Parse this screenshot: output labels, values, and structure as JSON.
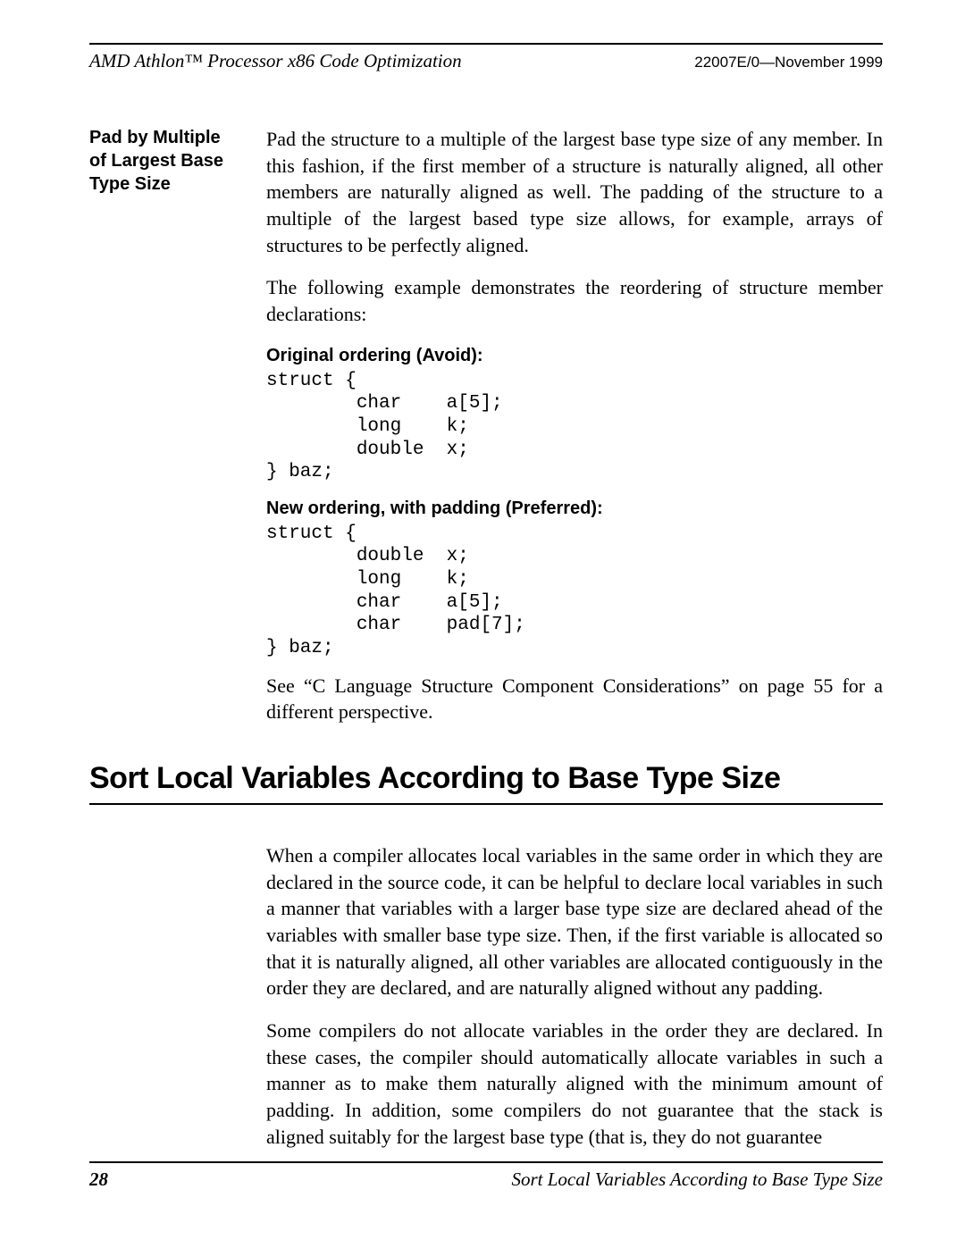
{
  "header": {
    "left": "AMD Athlon™ Processor x86 Code Optimization",
    "right": "22007E/0—November 1999"
  },
  "section1": {
    "side_heading": "Pad by Multiple of Largest Base Type Size",
    "p1": "Pad the structure to a multiple of the largest base type size of any member. In this fashion, if the first member of a structure is naturally aligned, all other members are naturally aligned as well. The padding of the structure to a multiple of the largest based type size allows, for example, arrays of structures to be perfectly aligned.",
    "p2": "The following example demonstrates the reordering of structure member declarations:",
    "code1_heading": "Original ordering (Avoid):",
    "code1": "struct {\n        char    a[5];\n        long    k;\n        double  x;\n} baz;",
    "code2_heading": "New ordering, with padding (Preferred):",
    "code2": "struct {\n        double  x;\n        long    k;\n        char    a[5];\n        char    pad[7];\n} baz;",
    "p3": "See “C Language Structure Component Considerations” on page 55 for a different perspective."
  },
  "main_heading": "Sort Local Variables According to Base Type Size",
  "section2": {
    "p1": "When a compiler allocates local variables in the same order in which they are declared in the source code, it can be helpful to declare local variables in such a manner that variables with a larger base type size are declared ahead of the variables with smaller base type size. Then, if the first variable is allocated so that it is naturally aligned, all other variables are allocated contiguously in the order they are declared, and are naturally aligned without any padding.",
    "p2": "Some compilers do not allocate variables in the order they are declared. In these cases, the compiler should automatically allocate variables in such a manner as to make them naturally aligned with the minimum amount of padding. In addition, some compilers do not guarantee that the stack is aligned suitably for the largest base type (that is, they do not guarantee"
  },
  "footer": {
    "page": "28",
    "title": "Sort Local Variables According to Base Type Size"
  }
}
